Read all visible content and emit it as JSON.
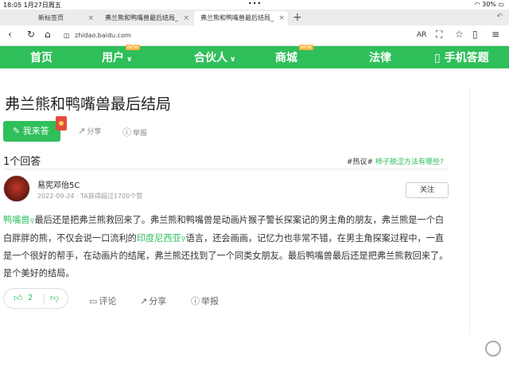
{
  "status_bar": {
    "time": "18:05",
    "date": "1月27日周五",
    "battery": "30%"
  },
  "tabs": [
    {
      "label": "新标签页"
    },
    {
      "label": "弗兰熊和鸭嘴兽最后结局_"
    },
    {
      "label": "弗兰熊和鸭嘴兽最后结局_"
    }
  ],
  "address_bar": {
    "url": "zhidao.baidu.com",
    "ar_label": "AR"
  },
  "nav": {
    "items": [
      {
        "label": "首页"
      },
      {
        "label": "用户"
      },
      {
        "label": "合伙人"
      },
      {
        "label": "商城"
      },
      {
        "label": "法律"
      },
      {
        "label": "手机答题"
      }
    ],
    "new_badge": "NEW"
  },
  "question": {
    "title": "弗兰熊和鸭嘴兽最后结局"
  },
  "actions": {
    "answer": "我来答",
    "share": "分享",
    "report": "举报"
  },
  "answers": {
    "count_label": "1个回答",
    "hot_tag": "#热议#",
    "hot_question": "柿子脱涩方法有哪些?"
  },
  "answer": {
    "username": "易宪邓佁5C",
    "meta": "2022-09-24 · TA获得超过1700个赞",
    "follow": "关注",
    "link1": "鸭嘴兽",
    "text1": "最后还是把弗兰熊救回来了。弗兰熊和鸭嘴兽是动画片猴子警长探案记的男主角的朋友，弗兰熊是一个白白胖胖的熊，不仅会说一口流利的",
    "link2": "印度尼西亚",
    "text2": "语言，还会画画，记忆力也非常不错，在男主角探案过程中，一直是一个很好的帮手，在动画片的结尾，弗兰熊还找到了一个同类女朋友。最后鸭嘴兽最后还是把弗兰熊救回来了。是个美好的结局。",
    "likes": "2",
    "comment": "评论",
    "share": "分享",
    "report": "举报"
  },
  "colors": {
    "brand": "#2fbf5a"
  }
}
